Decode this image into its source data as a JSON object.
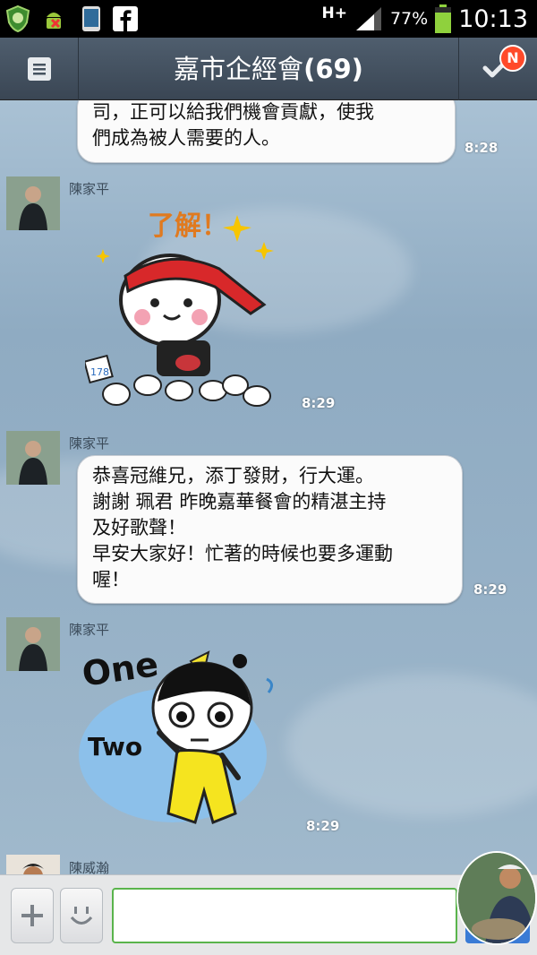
{
  "status": {
    "network": "H+",
    "battery": "77%",
    "time": "10:13"
  },
  "header": {
    "title": "嘉市企經會",
    "count": "(69)",
    "notify_badge": "N"
  },
  "messages": [
    {
      "type": "text",
      "text": "司，正可以給我們機會貢獻，使我\n們成為被人需要的人。",
      "time": "8:28"
    },
    {
      "type": "sticker",
      "sender": "陳家平",
      "sticker_text": "了解！",
      "sticker_badge": "178",
      "time": "8:29"
    },
    {
      "type": "text",
      "sender": "陳家平",
      "text": "恭喜冠維兄，添丁發財，行大運。\n謝謝 珮君 昨晚嘉華餐會的精湛主持\n及好歌聲！\n早安大家好！忙著的時候也要多運動\n喔！",
      "time": "8:29"
    },
    {
      "type": "sticker",
      "sender": "陳家平",
      "sticker_text_1": "One",
      "sticker_text_2": "Two",
      "time": "8:29"
    },
    {
      "type": "partial",
      "sender": "陳威瀚"
    }
  ],
  "input": {
    "value": "",
    "placeholder": ""
  },
  "icons": {
    "menu": "menu-icon",
    "check": "check-icon",
    "add": "plus-icon",
    "emoji": "smiley-icon"
  },
  "colors": {
    "header": "#45525f",
    "input_border": "#5ab44c",
    "badge": "#ff4a2a"
  }
}
